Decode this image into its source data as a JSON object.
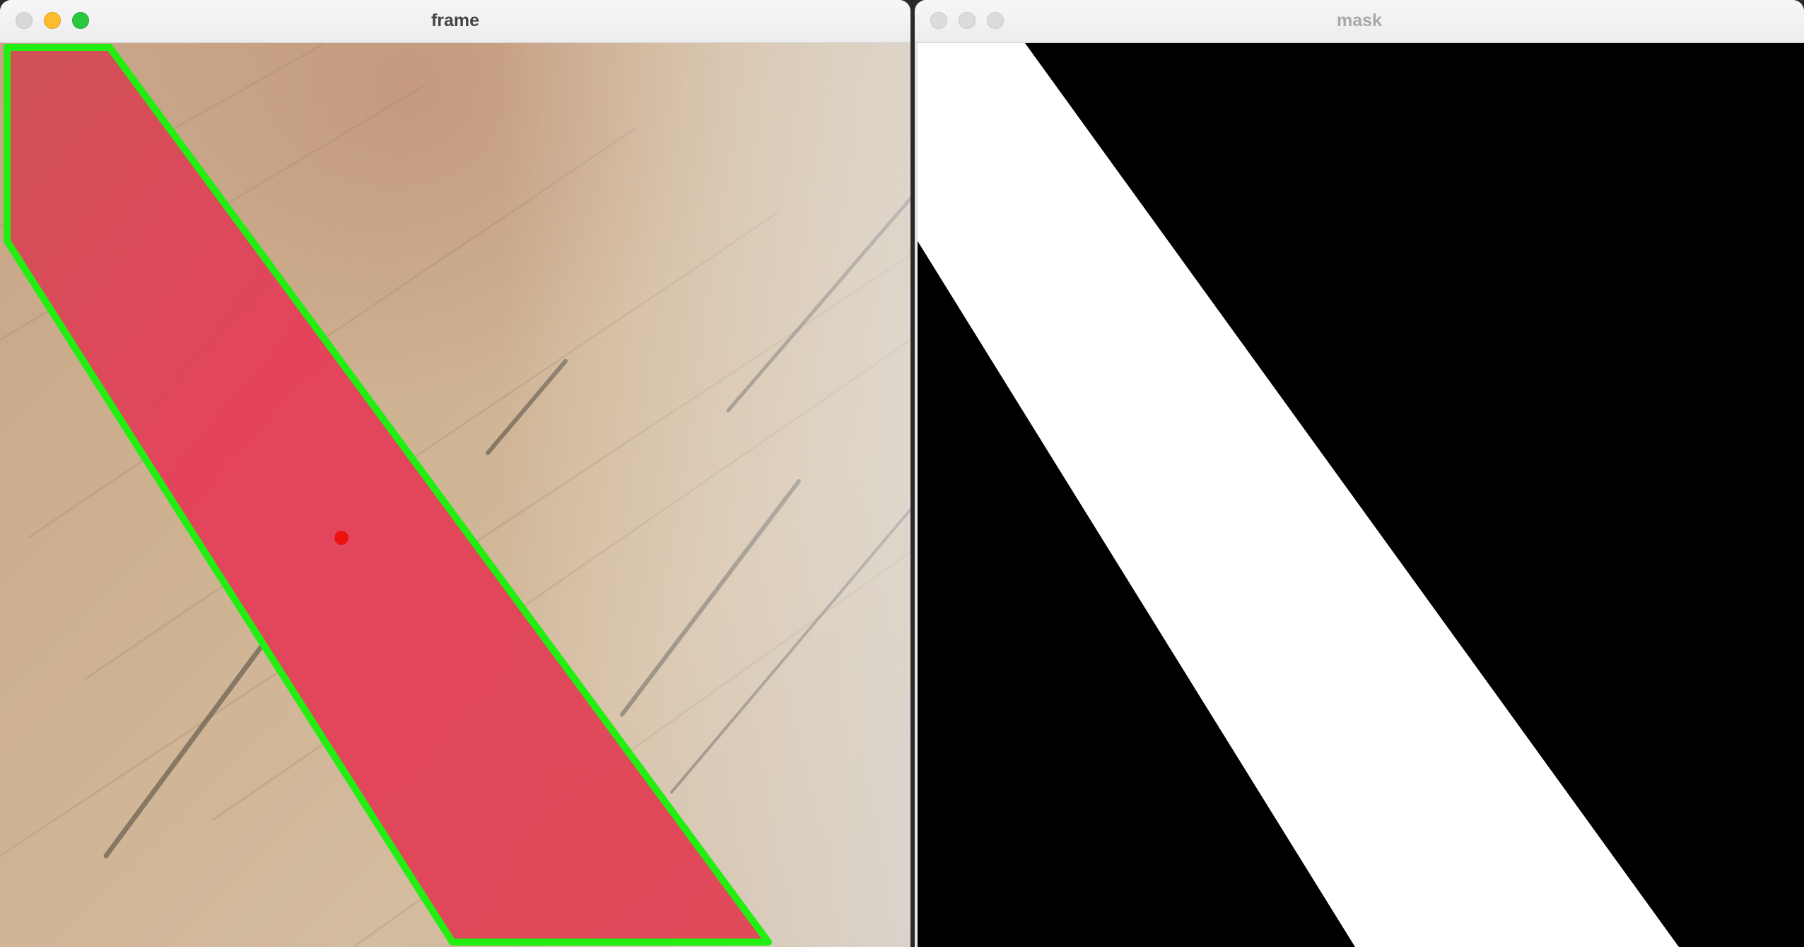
{
  "windows": [
    {
      "title": "frame",
      "active": true,
      "controls": [
        "close",
        "minimize",
        "zoom"
      ],
      "colors": {
        "overlay_fill": "#e0364f",
        "contour": "#22ee11",
        "centroid": "#ee1111",
        "background": "#c9ae8d"
      },
      "layers": [
        "wood-texture-background",
        "red-tape-region",
        "green-contour",
        "red-centroid-dot"
      ]
    },
    {
      "title": "mask",
      "active": false,
      "controls": [
        "close",
        "minimize",
        "zoom"
      ],
      "colors": {
        "foreground": "#ffffff",
        "background": "#000000"
      },
      "layers": [
        "binary-mask-stripe"
      ]
    }
  ]
}
